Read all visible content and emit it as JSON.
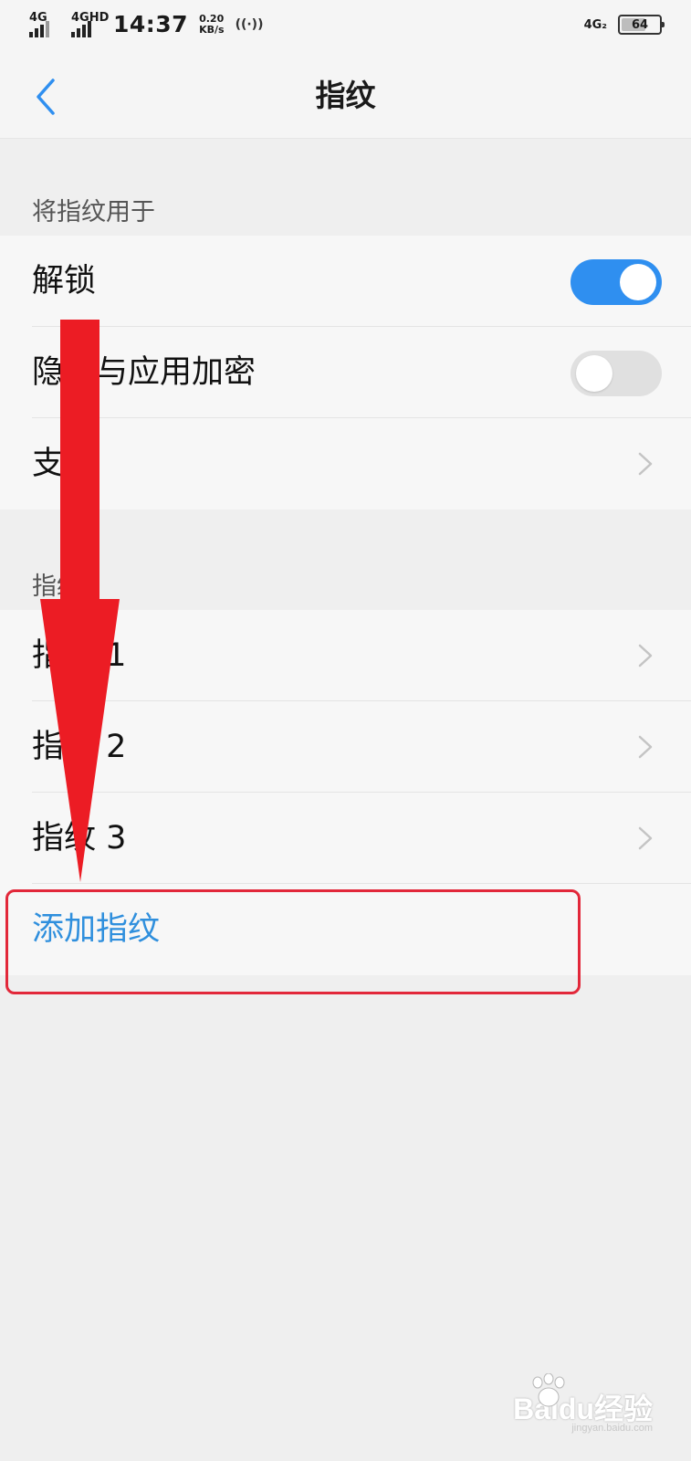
{
  "status_bar": {
    "network1": "4G",
    "network2": "4GHD",
    "time": "14:37",
    "speed_value": "0.20",
    "speed_unit": "KB/s",
    "sim2_label": "4G₂",
    "battery_level": "64"
  },
  "header": {
    "title": "指纹"
  },
  "section_use": {
    "header": "将指纹用于",
    "items": [
      {
        "label": "解锁",
        "toggle": "on"
      },
      {
        "label": "隐私与应用加密",
        "toggle": "off"
      },
      {
        "label": "支付"
      }
    ]
  },
  "section_fingerprints": {
    "header": "指纹",
    "items": [
      {
        "label": "指纹 1"
      },
      {
        "label": "指纹 2"
      },
      {
        "label": "指纹 3"
      }
    ],
    "add_label": "添加指纹"
  },
  "annotation": {
    "arrow_color": "#ec1c24",
    "box_color": "#e2283a"
  },
  "watermark": {
    "text": "Baidu经验",
    "sub": "jingyan.baidu.com"
  },
  "colors": {
    "accent": "#2f8ff0",
    "link": "#2f8fdd"
  }
}
